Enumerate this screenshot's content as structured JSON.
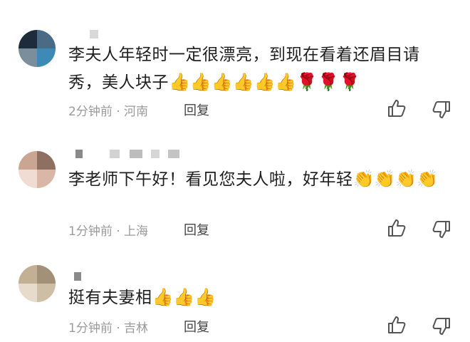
{
  "comments": [
    {
      "text": "李夫人年轻时一定很漂亮，到现在看着还眉目请秀，美人块子",
      "emoji": "👍👍👍👍👍👍🌹🌹🌹",
      "time": "2分钟前",
      "location": "河南",
      "reply_label": "回复"
    },
    {
      "text": "李老师下午好！看见您夫人啦，好年轻",
      "emoji": "👏👏👏👏",
      "time": "1分钟前",
      "location": "上海",
      "reply_label": "回复"
    },
    {
      "text": "挺有夫妻相",
      "emoji": "👍👍👍",
      "time": "1分钟前",
      "location": "吉林",
      "reply_label": "回复"
    }
  ],
  "meta_separator": "·",
  "icons": {
    "like": "thumbs-up-icon",
    "dislike": "thumbs-down-icon"
  },
  "colors": {
    "meta": "#9a9a9a",
    "text": "#1f1f1f"
  }
}
